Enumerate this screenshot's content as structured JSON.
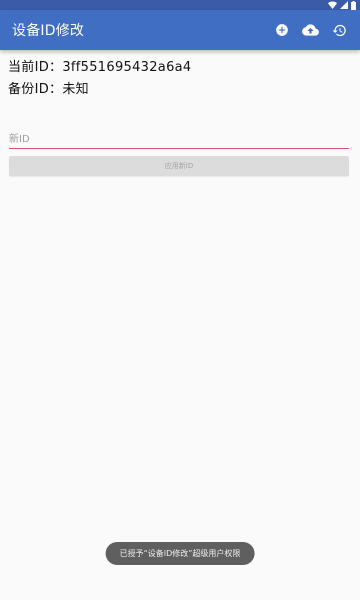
{
  "app": {
    "title": "设备ID修改",
    "accent_color": "#3f6ec2",
    "status_bar_color": "#3a5ba8"
  },
  "status_bar": {
    "icons": [
      "wifi-icon",
      "signal-icon",
      "battery-icon"
    ]
  },
  "toolbar": {
    "actions": [
      {
        "icon": "add-circle-icon"
      },
      {
        "icon": "cloud-upload-icon"
      },
      {
        "icon": "restore-icon"
      }
    ]
  },
  "info": {
    "current_id_text": "当前ID：3ff551695432a6a4",
    "backup_id_text": "备份ID：未知"
  },
  "form": {
    "new_id_placeholder": "新ID",
    "new_id_value": "",
    "input_underline_color": "#d65a6e",
    "apply_button_label": "应用新ID",
    "apply_button_state": "disabled"
  },
  "toast": {
    "message": "已授予“设备ID修改”超级用户权限"
  }
}
